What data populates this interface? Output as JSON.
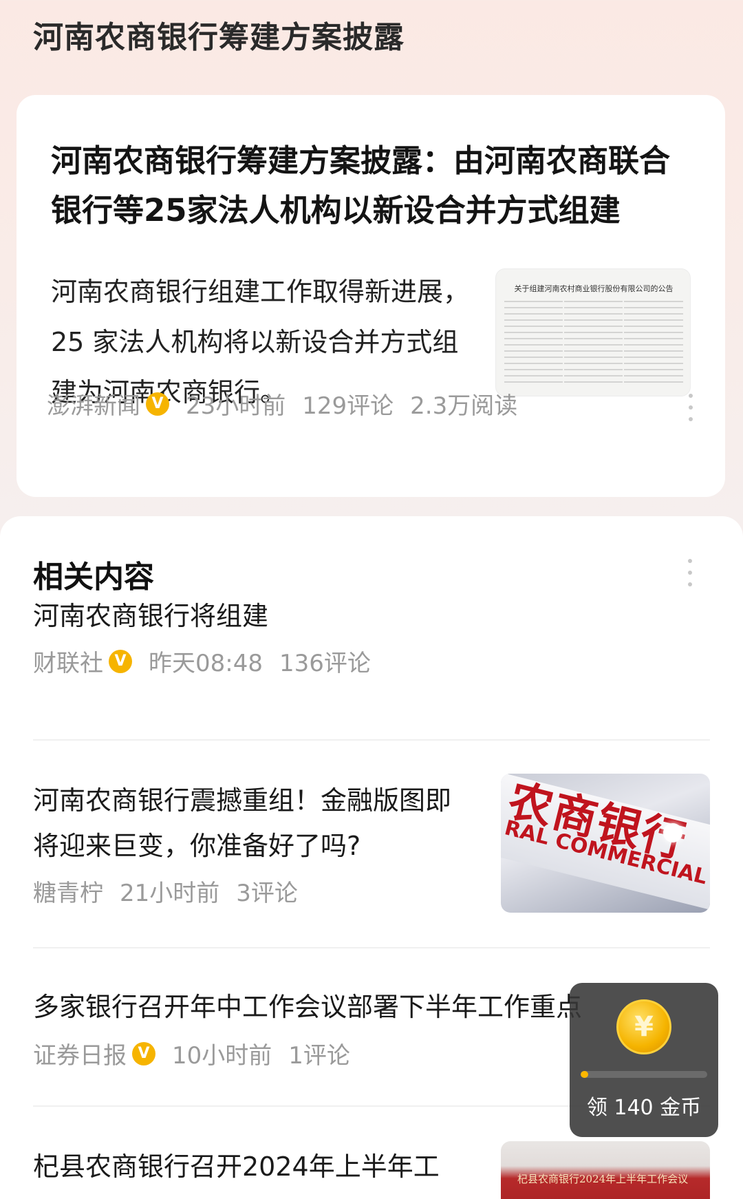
{
  "page_title": "河南农商银行筹建方案披露",
  "hero": {
    "headline": "河南农商银行筹建方案披露：由河南农商联合银行等25家法人机构以新设合并方式组建",
    "summary": "河南农商银行组建工作取得新进展，25 家法人机构将以新设合并方式组建为河南农商银行。",
    "thumb_doc_title": "关于组建河南农村商业银行股份有限公司的公告",
    "source": "澎湃新闻",
    "verified_badge": "V",
    "time": "23小时前",
    "comments": "129评论",
    "reads": "2.3万阅读"
  },
  "related": {
    "title": "相关内容",
    "items": [
      {
        "title": "河南农商银行将组建",
        "source": "财联社",
        "verified": true,
        "time": "昨天08:48",
        "comments": "136评论"
      },
      {
        "title": "河南农商银行震撼重组！金融版图即将迎来巨变，你准备好了吗?",
        "source": "糖青柠",
        "verified": false,
        "time": "21小时前",
        "comments": "3评论",
        "thumb_text_cn": "农商银行",
        "thumb_text_en": "RAL COMMERCIAL BANK"
      },
      {
        "title": "多家银行召开年中工作会议部署下半年工作重点",
        "source": "证券日报",
        "verified": true,
        "time": "10小时前",
        "comments": "1评论"
      },
      {
        "title": "杞县农商银行召开2024年上半年工",
        "thumb_banner": "杞县农商银行2024年上半年工作会议"
      }
    ]
  },
  "reward": {
    "coin_symbol": "¥",
    "label": "领 140 金币",
    "progress_fraction": 0.04,
    "accent_color": "#ffb800"
  },
  "icons": [
    "more-vertical-icon",
    "verified-badge-icon",
    "coin-icon"
  ]
}
